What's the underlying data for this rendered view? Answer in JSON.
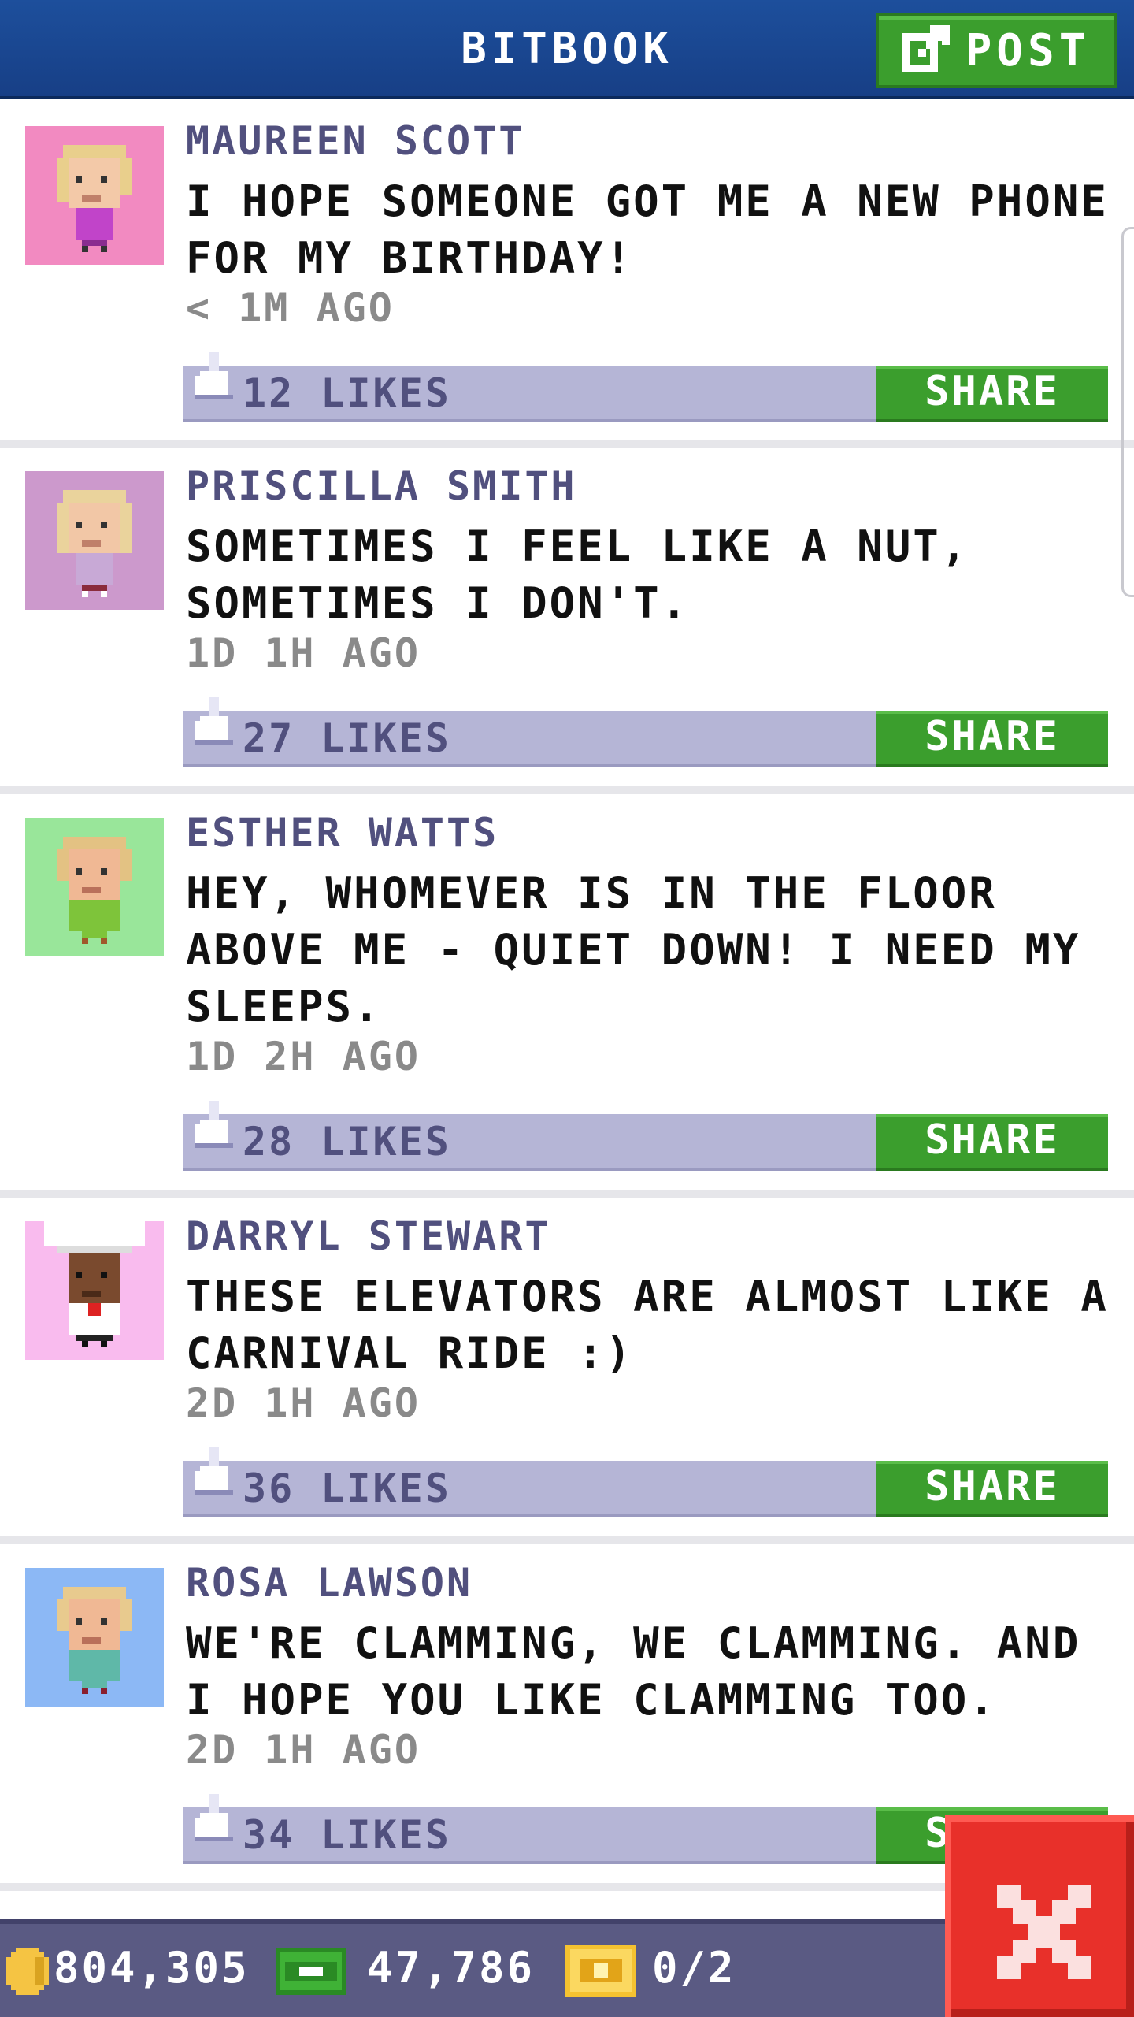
{
  "header": {
    "title": "BITBOOK",
    "post_label": "POST"
  },
  "posts": [
    {
      "name": "MAUREEN SCOTT",
      "text": "I HOPE SOMEONE GOT ME A NEW PHONE FOR MY BIRTHDAY!",
      "time": "< 1M AGO",
      "likes": "12 LIKES",
      "share_label": "SHARE"
    },
    {
      "name": "PRISCILLA SMITH",
      "text": "SOMETIMES I FEEL LIKE A NUT, SOMETIMES I DON'T.",
      "time": "1D 1H AGO",
      "likes": "27 LIKES",
      "share_label": "SHARE"
    },
    {
      "name": "ESTHER WATTS",
      "text": "HEY, WHOMEVER IS IN THE FLOOR ABOVE ME - QUIET DOWN! I NEED MY SLEEPS.",
      "time": "1D 2H AGO",
      "likes": "28 LIKES",
      "share_label": "SHARE"
    },
    {
      "name": "DARRYL STEWART",
      "text": "THESE ELEVATORS ARE ALMOST LIKE A CARNIVAL RIDE :)",
      "time": "2D 1H AGO",
      "likes": "36 LIKES",
      "share_label": "SHARE"
    },
    {
      "name": "ROSA LAWSON",
      "text": "WE'RE CLAMMING, WE CLAMMING. AND I HOPE YOU LIKE CLAMMING TOO.",
      "time": "2D 1H AGO",
      "likes": "34 LIKES",
      "share_label": "SHARE"
    }
  ],
  "status": {
    "coins": "804,305",
    "bux": "47,786",
    "tickets": "0/2"
  },
  "icons": {
    "post": "edit-icon",
    "like": "thumbs-up-icon",
    "coin": "coin-icon",
    "bux": "bux-icon",
    "ticket": "ticket-icon",
    "close": "close-icon"
  },
  "colors": {
    "header": "#1d4f9c",
    "share": "#3b9e2d",
    "likebar": "#b5b5d6",
    "close": "#e8302a",
    "name": "#51507e"
  }
}
